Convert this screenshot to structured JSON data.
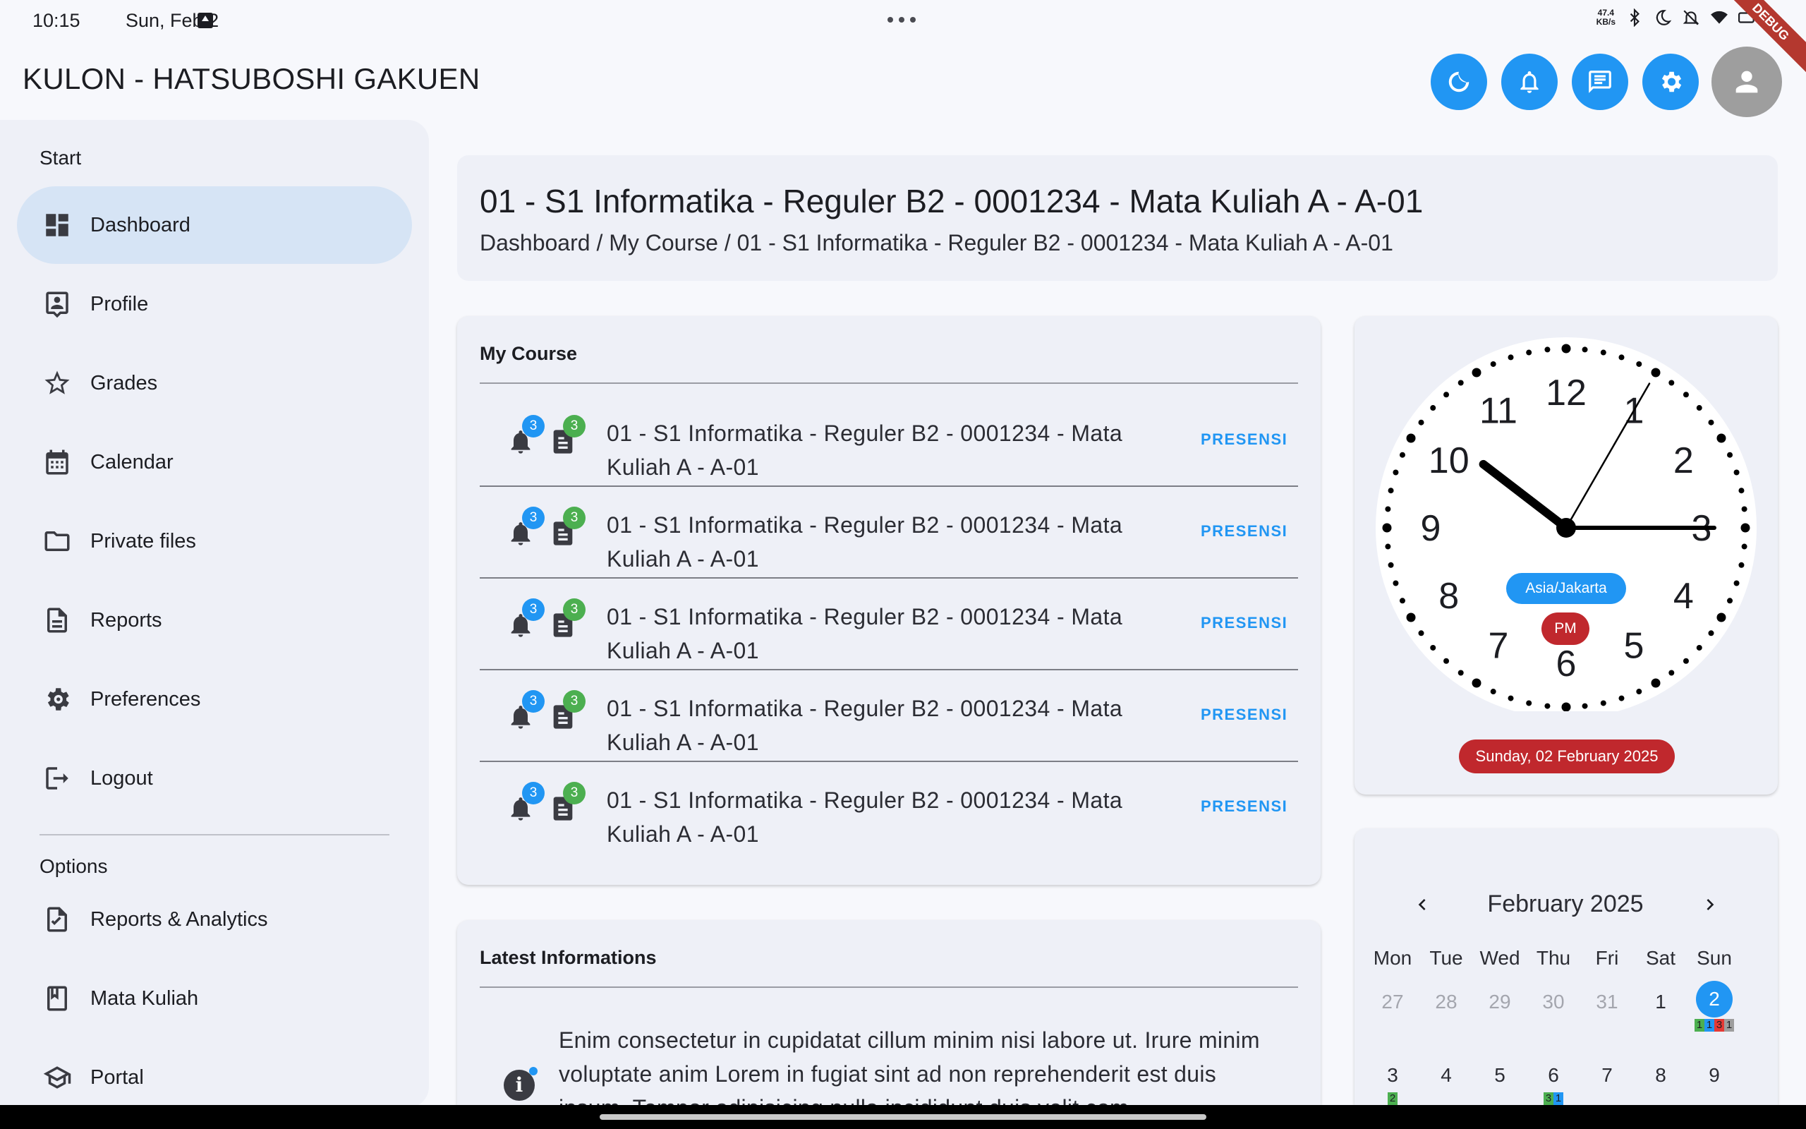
{
  "status": {
    "time": "10:15",
    "date": "Sun, Feb 2",
    "net_speed_value": "47.4",
    "net_speed_unit": "KB/s",
    "debug_label": "DEBUG"
  },
  "header": {
    "title": "KULON - HATSUBOSHI GAKUEN",
    "buttons": [
      "moon-icon",
      "bell-icon",
      "chat-icon",
      "gear-icon",
      "account-icon"
    ]
  },
  "sidebar": {
    "start_label": "Start",
    "options_label": "Options",
    "items": [
      {
        "label": "Dashboard",
        "icon": "dashboard-icon",
        "active": true
      },
      {
        "label": "Profile",
        "icon": "profile-icon"
      },
      {
        "label": "Grades",
        "icon": "star-icon"
      },
      {
        "label": "Calendar",
        "icon": "calendar-icon"
      },
      {
        "label": "Private files",
        "icon": "folder-icon"
      },
      {
        "label": "Reports",
        "icon": "report-icon"
      },
      {
        "label": "Preferences",
        "icon": "gear-icon"
      },
      {
        "label": "Logout",
        "icon": "logout-icon"
      }
    ],
    "options": [
      {
        "label": "Reports & Analytics",
        "icon": "report-check-icon"
      },
      {
        "label": "Mata Kuliah",
        "icon": "book-icon"
      },
      {
        "label": "Portal",
        "icon": "school-icon"
      }
    ]
  },
  "page": {
    "title": "01 - S1 Informatika - Reguler B2 - 0001234 - Mata Kuliah A - A-01",
    "breadcrumb": "Dashboard / My Course / 01 - S1 Informatika - Reguler B2 - 0001234 - Mata Kuliah A - A-01"
  },
  "my_course": {
    "title": "My Course",
    "action_label": "PRESENSI",
    "rows": [
      {
        "name": "01 - S1 Informatika - Reguler B2 - 0001234 - Mata Kuliah A - A-01",
        "notif_count": "3",
        "doc_count": "3"
      },
      {
        "name": "01 - S1 Informatika - Reguler B2 - 0001234 - Mata Kuliah A - A-01",
        "notif_count": "3",
        "doc_count": "3"
      },
      {
        "name": "01 - S1 Informatika - Reguler B2 - 0001234 - Mata Kuliah A - A-01",
        "notif_count": "3",
        "doc_count": "3"
      },
      {
        "name": "01 - S1 Informatika - Reguler B2 - 0001234 - Mata Kuliah A - A-01",
        "notif_count": "3",
        "doc_count": "3"
      },
      {
        "name": "01 - S1 Informatika - Reguler B2 - 0001234 - Mata Kuliah A - A-01",
        "notif_count": "3",
        "doc_count": "3"
      }
    ]
  },
  "latest_info": {
    "title": "Latest Informations",
    "text": "Enim consectetur in cupidatat cillum minim nisi labore ut. Irure minim voluptate anim Lorem in fugiat sint ad non reprehenderit est duis ipsum. Tempor adipisicing nulla incididunt duis velit com"
  },
  "clock": {
    "hour": 10,
    "minute": 15,
    "second": 5,
    "numbers": [
      "12",
      "1",
      "2",
      "3",
      "4",
      "5",
      "6",
      "7",
      "8",
      "9",
      "10",
      "11"
    ],
    "timezone": "Asia/Jakarta",
    "period": "PM",
    "date_label": "Sunday, 02 February 2025",
    "colors": {
      "timezone": "#2196f3",
      "period": "#c0282d",
      "date": "#c0282d"
    }
  },
  "calendar": {
    "month": "February 2025",
    "weekdays": [
      "Mon",
      "Tue",
      "Wed",
      "Thu",
      "Fri",
      "Sat",
      "Sun"
    ],
    "row1": [
      "27",
      "28",
      "29",
      "30",
      "31",
      "1",
      "2"
    ],
    "row2": [
      "3",
      "4",
      "5",
      "6",
      "7",
      "8",
      "9"
    ],
    "today": "2",
    "marks_today": [
      "1",
      "1",
      "3",
      "1"
    ],
    "marks_3": [
      "2"
    ],
    "marks_6": [
      "3",
      "1"
    ],
    "mark_colors": [
      "#4caf50",
      "#2196f3",
      "#e53935",
      "#9e9e9e"
    ]
  }
}
